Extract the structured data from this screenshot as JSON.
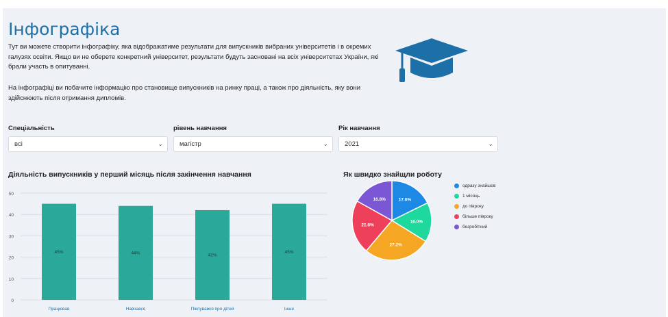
{
  "page": {
    "title": "Інфографіка",
    "intro": "Тут ви можете створити інфографіку, яка відображатиме результати для випускників вибраних університетів і в окремих галузях освіти. Якщо ви не оберете конкретний університет, результати будуть засновані на всіх університетах України, які брали участь в опитуванні.",
    "intro2": "На інфографіці ви побачите інформацію про становище випускників на ринку праці, а також про діяльність, яку вони здійснюють після отримання дипломів."
  },
  "icons": {
    "hero": "graduation-cap-icon",
    "chevron": "chevron-down-icon"
  },
  "filters": [
    {
      "label": "Спеціальність",
      "value": "всі"
    },
    {
      "label": "рівень навчання",
      "value": "магістр"
    },
    {
      "label": "Рік навчання",
      "value": "2021"
    }
  ],
  "colors": {
    "title": "#1d6fa8",
    "bar": "#2aa89a",
    "accent": "#1d6fa8"
  },
  "chart_data": [
    {
      "type": "bar",
      "title": "Діяльність випускників у перший місяць після закінчення навчання",
      "categories": [
        "Працював",
        "Навчався",
        "Піклувався про дітей",
        "Інше"
      ],
      "values": [
        45,
        44,
        42,
        45
      ],
      "labels": [
        "45%",
        "44%",
        "42%",
        "45%"
      ],
      "ylim": [
        0,
        50
      ],
      "yticks": [
        0,
        10,
        20,
        30,
        40,
        50
      ],
      "grid": true,
      "color": "#2aa89a"
    },
    {
      "type": "pie",
      "title": "Як швидко знайщли роботу",
      "categories": [
        "одразу знайшов",
        "1 місяць",
        "до півроку",
        "більше півроку",
        "безробітний"
      ],
      "values": [
        17.6,
        16.0,
        27.2,
        21.8,
        16.8
      ],
      "labels": [
        "17.6%",
        "16.0%",
        "27.2%",
        "21.8%",
        "16.8%"
      ],
      "colors": [
        "#1e88e5",
        "#1ed89e",
        "#f5a623",
        "#ee3f5b",
        "#7b57d6"
      ],
      "legend": "right"
    }
  ]
}
